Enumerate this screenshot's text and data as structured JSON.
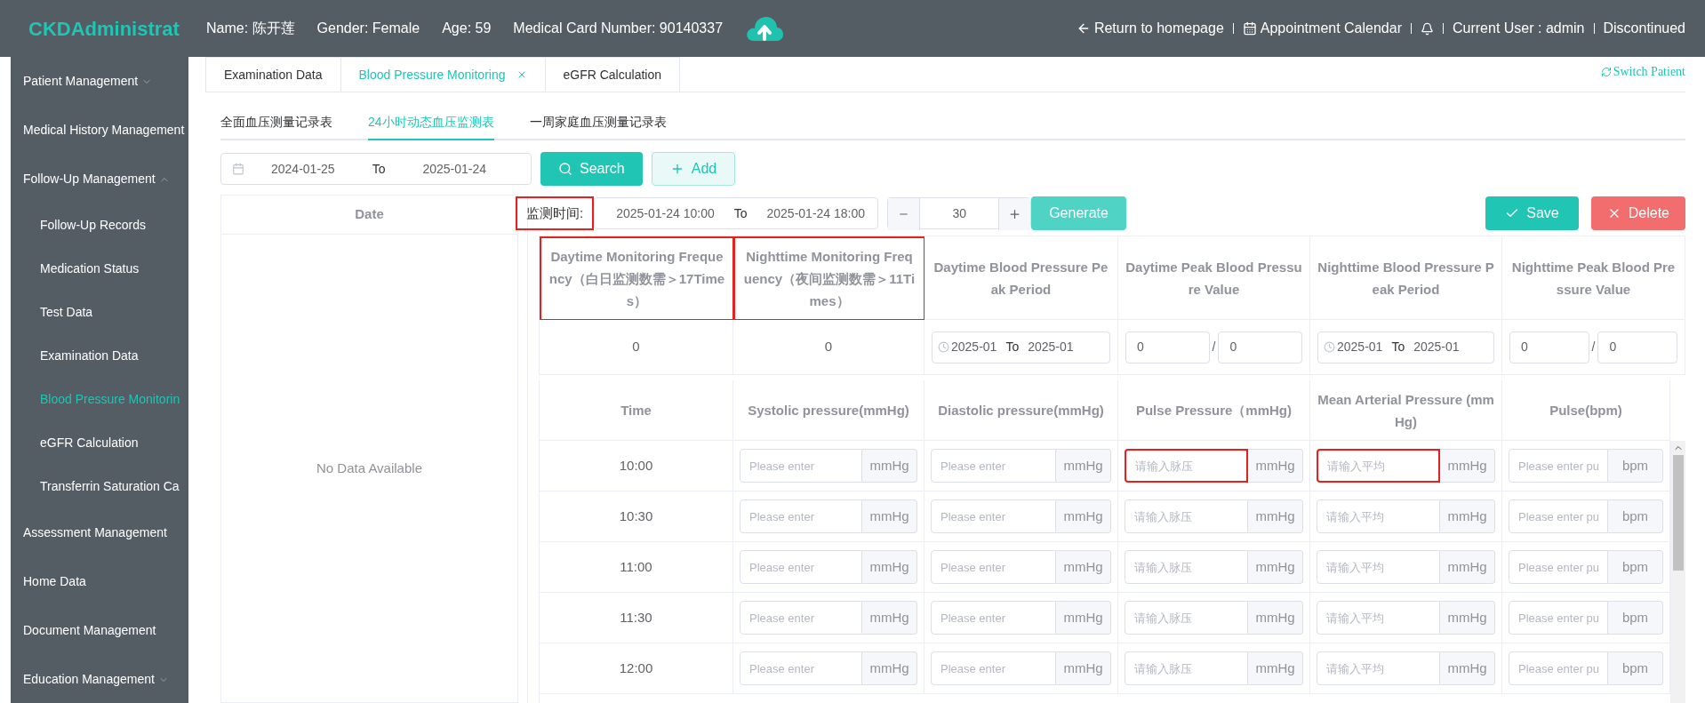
{
  "app": {
    "title": "CKDAdministrat"
  },
  "patient": [
    "Name: 陈开莲",
    "Gender: Female",
    "Age: 59",
    "Medical Card Number: 90140337"
  ],
  "header_links": [
    {
      "kind": "back",
      "label": "Return to homepage"
    },
    {
      "kind": "calendar",
      "label": "Appointment Calendar"
    },
    {
      "kind": "bell"
    },
    {
      "kind": "text",
      "label": "Current User : admin"
    },
    {
      "kind": "text",
      "label": "Discontinued"
    }
  ],
  "sidebar": {
    "items": [
      {
        "label": "Patient Management",
        "expanded": false,
        "selected": false
      },
      {
        "label": "Medical History Management",
        "selected": false
      },
      {
        "label": "Follow-Up Management",
        "expanded": true,
        "selected": false,
        "children": [
          {
            "label": "Follow-Up Records",
            "selected": false
          },
          {
            "label": "Medication Status",
            "selected": false
          },
          {
            "label": "Test Data",
            "selected": false
          },
          {
            "label": "Examination Data",
            "selected": false
          },
          {
            "label": "Blood Pressure Monitorin",
            "selected": true
          },
          {
            "label": "eGFR Calculation",
            "selected": false
          },
          {
            "label": "Transferrin Saturation Ca",
            "selected": false
          }
        ]
      },
      {
        "label": "Assessment Management",
        "selected": false
      },
      {
        "label": "Home Data",
        "selected": false
      },
      {
        "label": "Document Management",
        "selected": false
      },
      {
        "label": "Education Management",
        "expanded": false,
        "selected": false
      }
    ]
  },
  "tabs": [
    {
      "label": "Examination Data",
      "selected": false,
      "closable": false
    },
    {
      "label": "Blood Pressure Monitoring",
      "selected": true,
      "closable": true
    },
    {
      "label": "eGFR Calculation",
      "selected": false,
      "closable": false
    }
  ],
  "switch_patient": "Switch Patient",
  "subtabs": [
    {
      "label": "全面血压测量记录表",
      "selected": false
    },
    {
      "label": "24小时动态血压监测表",
      "selected": true
    },
    {
      "label": "一周家庭血压测量记录表",
      "selected": false
    }
  ],
  "filter": {
    "start": "2024-01-25",
    "separator": "To",
    "end": "2025-01-24",
    "search": "Search",
    "add": "Add"
  },
  "date_panel": {
    "header": "Date",
    "empty": "No Data Available"
  },
  "monitoring": {
    "label": "监测时间:",
    "highlighted": true,
    "start": "2025-01-24 10:00",
    "separator": "To",
    "end": "2025-01-24 18:00",
    "interval": "30",
    "generate": "Generate",
    "save": "Save",
    "delete": "Delete"
  },
  "summary": {
    "headers": [
      {
        "label": "Daytime Monitoring Frequency（白日监测数需＞17Times）",
        "highlighted": true
      },
      {
        "label": "Nighttime Monitoring Frequency（夜间监测数需＞11Times）",
        "highlighted": true
      },
      {
        "label": "Daytime Blood Pressure Peak Period",
        "highlighted": false
      },
      {
        "label": "Daytime Peak Blood Pressure Value",
        "highlighted": false
      },
      {
        "label": "Nighttime Blood Pressure Peak Period",
        "highlighted": false
      },
      {
        "label": "Nighttime Peak Blood Pressure Value",
        "highlighted": false
      }
    ],
    "cells": [
      {
        "kind": "text",
        "value": "0"
      },
      {
        "kind": "text",
        "value": "0"
      },
      {
        "kind": "time_range",
        "start": "2025-01",
        "separator": "To",
        "end": "2025-01"
      },
      {
        "kind": "pair",
        "first": "0",
        "separator": "/",
        "second": "0"
      },
      {
        "kind": "time_range",
        "start": "2025-01",
        "separator": "To",
        "end": "2025-01"
      },
      {
        "kind": "pair",
        "first": "0",
        "separator": "/",
        "second": "0"
      }
    ]
  },
  "readings": {
    "columns": [
      "Time",
      "Systolic pressure(mmHg)",
      "Diastolic pressure(mmHg)",
      "Pulse Pressure（mmHg)",
      "Mean Arterial Pressure (mmHg)",
      "Pulse(bpm)"
    ],
    "rows": [
      {
        "cells": [
          {
            "kind": "time",
            "text": "10:00"
          },
          {
            "kind": "input",
            "placeholder": "Please enter",
            "unit": "mmHg",
            "highlighted": false
          },
          {
            "kind": "input",
            "placeholder": "Please enter",
            "unit": "mmHg",
            "highlighted": false
          },
          {
            "kind": "input",
            "placeholder": "请输入脉压",
            "unit": "mmHg",
            "highlighted": true
          },
          {
            "kind": "input",
            "placeholder": "请输入平均",
            "unit": "mmHg",
            "highlighted": true
          },
          {
            "kind": "input",
            "placeholder": "Please enter pu",
            "unit": "bpm",
            "highlighted": false
          }
        ]
      },
      {
        "cells": [
          {
            "kind": "time",
            "text": "10:30"
          },
          {
            "kind": "input",
            "placeholder": "Please enter",
            "unit": "mmHg",
            "highlighted": false
          },
          {
            "kind": "input",
            "placeholder": "Please enter",
            "unit": "mmHg",
            "highlighted": false
          },
          {
            "kind": "input",
            "placeholder": "请输入脉压",
            "unit": "mmHg",
            "highlighted": false
          },
          {
            "kind": "input",
            "placeholder": "请输入平均",
            "unit": "mmHg",
            "highlighted": false
          },
          {
            "kind": "input",
            "placeholder": "Please enter pu",
            "unit": "bpm",
            "highlighted": false
          }
        ]
      },
      {
        "cells": [
          {
            "kind": "time",
            "text": "11:00"
          },
          {
            "kind": "input",
            "placeholder": "Please enter",
            "unit": "mmHg",
            "highlighted": false
          },
          {
            "kind": "input",
            "placeholder": "Please enter",
            "unit": "mmHg",
            "highlighted": false
          },
          {
            "kind": "input",
            "placeholder": "请输入脉压",
            "unit": "mmHg",
            "highlighted": false
          },
          {
            "kind": "input",
            "placeholder": "请输入平均",
            "unit": "mmHg",
            "highlighted": false
          },
          {
            "kind": "input",
            "placeholder": "Please enter pu",
            "unit": "bpm",
            "highlighted": false
          }
        ]
      },
      {
        "cells": [
          {
            "kind": "time",
            "text": "11:30"
          },
          {
            "kind": "input",
            "placeholder": "Please enter",
            "unit": "mmHg",
            "highlighted": false
          },
          {
            "kind": "input",
            "placeholder": "Please enter",
            "unit": "mmHg",
            "highlighted": false
          },
          {
            "kind": "input",
            "placeholder": "请输入脉压",
            "unit": "mmHg",
            "highlighted": false
          },
          {
            "kind": "input",
            "placeholder": "请输入平均",
            "unit": "mmHg",
            "highlighted": false
          },
          {
            "kind": "input",
            "placeholder": "Please enter pu",
            "unit": "bpm",
            "highlighted": false
          }
        ]
      },
      {
        "cells": [
          {
            "kind": "time",
            "text": "12:00"
          },
          {
            "kind": "input",
            "placeholder": "Please enter",
            "unit": "mmHg",
            "highlighted": false
          },
          {
            "kind": "input",
            "placeholder": "Please enter",
            "unit": "mmHg",
            "highlighted": false
          },
          {
            "kind": "input",
            "placeholder": "请输入脉压",
            "unit": "mmHg",
            "highlighted": false
          },
          {
            "kind": "input",
            "placeholder": "请输入平均",
            "unit": "mmHg",
            "highlighted": false
          },
          {
            "kind": "input",
            "placeholder": "Please enter pu",
            "unit": "bpm",
            "highlighted": false
          }
        ]
      }
    ]
  }
}
